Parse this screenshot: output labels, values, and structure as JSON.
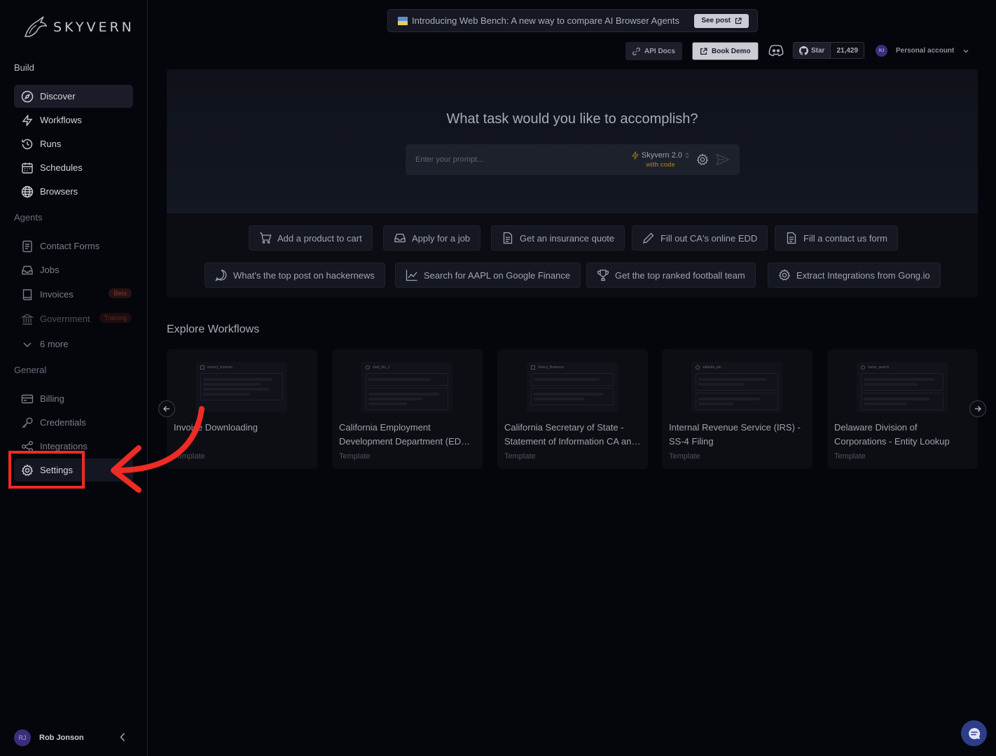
{
  "app": {
    "logo_text": "SKYVERN"
  },
  "sidebar": {
    "build_label": "Build",
    "build_items": [
      {
        "label": "Discover",
        "icon": "compass-icon"
      },
      {
        "label": "Workflows",
        "icon": "bolt-icon"
      },
      {
        "label": "Runs",
        "icon": "history-icon"
      },
      {
        "label": "Schedules",
        "icon": "calendar-icon"
      },
      {
        "label": "Browsers",
        "icon": "globe-icon"
      }
    ],
    "agents_label": "Agents",
    "agent_items": [
      {
        "label": "Contact Forms",
        "icon": "form-icon"
      },
      {
        "label": "Jobs",
        "icon": "inbox-icon"
      },
      {
        "label": "Invoices",
        "icon": "book-icon",
        "badge": "Beta"
      },
      {
        "label": "Government",
        "icon": "building-icon",
        "badge": "Training"
      }
    ],
    "more_label": "6 more",
    "general_label": "General",
    "general_items": [
      {
        "label": "Billing",
        "icon": "card-icon"
      },
      {
        "label": "Credentials",
        "icon": "key-icon"
      },
      {
        "label": "Integrations",
        "icon": "share-icon"
      },
      {
        "label": "Settings",
        "icon": "gear-icon"
      }
    ],
    "user": {
      "initials": "RJ",
      "name": "Rob Jonson"
    }
  },
  "header": {
    "announcement": "Introducing Web Bench: A new way to compare AI Browser Agents",
    "see_post": "See post",
    "api_docs": "API Docs",
    "book_demo": "Book Demo",
    "star_label": "Star",
    "star_count": "21,429",
    "account_initials": "RJ",
    "account_label": "Personal account"
  },
  "hero": {
    "title": "What task would you like to accomplish?",
    "prompt_placeholder": "Enter your prompt...",
    "model_name": "Skyvern 2.0",
    "model_sub": "with code",
    "suggestions_row1": [
      {
        "label": "Add a product to cart",
        "icon": "cart-icon"
      },
      {
        "label": "Apply for a job",
        "icon": "inbox-icon"
      },
      {
        "label": "Get an insurance quote",
        "icon": "document-icon"
      },
      {
        "label": "Fill out CA's online EDD",
        "icon": "pencil-icon"
      },
      {
        "label": "Fill a contact us form",
        "icon": "document-icon"
      }
    ],
    "suggestions_row2": [
      {
        "label": "What's the top post on hackernews",
        "icon": "chat-icon"
      },
      {
        "label": "Search for AAPL on Google Finance",
        "icon": "chart-icon"
      },
      {
        "label": "Get the top ranked football team",
        "icon": "trophy-icon"
      },
      {
        "label": "Extract Integrations from Gong.io",
        "icon": "gear-icon"
      }
    ]
  },
  "explore": {
    "title": "Explore Workflows",
    "cards": [
      {
        "thumb_title": "extract_invoices",
        "line1": "Invoice Downloading",
        "line2": "",
        "type": "Template"
      },
      {
        "thumb_title": "start_dis_1",
        "line1": "California Employment",
        "line2": "Development Department (EDD) Workflow",
        "type": "Template"
      },
      {
        "thumb_title": "Select_Business",
        "line1": "California Secretary of State -",
        "line2": "Statement of Information CA and Others",
        "type": "Template"
      },
      {
        "thumb_title": "validate_ein",
        "line1": "Internal Revenue Service (IRS) -",
        "line2": "SS-4 Filing",
        "type": "Template"
      },
      {
        "thumb_title": "name_search",
        "line1": "Delaware Division of",
        "line2": "Corporations - Entity Lookup",
        "type": "Template"
      }
    ]
  },
  "colors": {
    "highlight": "#ee2b24",
    "accent": "#8a6a1e",
    "background": "#05060c"
  }
}
